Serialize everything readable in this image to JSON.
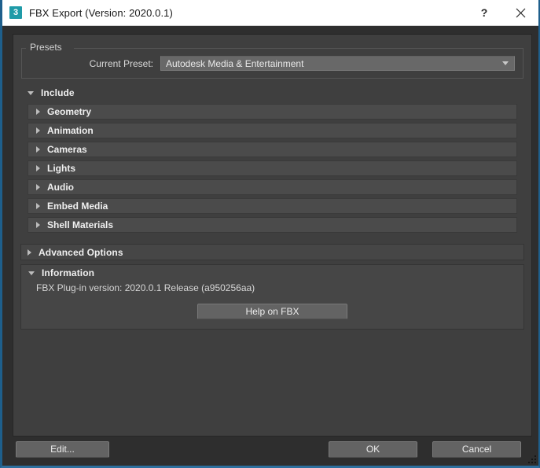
{
  "window": {
    "title": "FBX Export (Version: 2020.0.1)",
    "icon": "3",
    "icon_name": "3ds-max-icon",
    "help_glyph": "?",
    "accent_color": "#1e5f8c",
    "titlebar_bg": "#ffffff",
    "dialog_bg": "#2e2e2e",
    "panel_bg": "#464646"
  },
  "presets": {
    "group_title": "Presets",
    "label": "Current Preset:",
    "value": "Autodesk Media & Entertainment",
    "arrow_icon": "chevron-down-icon"
  },
  "include": {
    "label": "Include",
    "expanded": true,
    "arrow_icon": "triangle-down-icon",
    "items": [
      {
        "label": "Geometry",
        "arrow_icon": "triangle-right-icon",
        "expanded": false
      },
      {
        "label": "Animation",
        "arrow_icon": "triangle-right-icon",
        "expanded": false
      },
      {
        "label": "Cameras",
        "arrow_icon": "triangle-right-icon",
        "expanded": false
      },
      {
        "label": "Lights",
        "arrow_icon": "triangle-right-icon",
        "expanded": false
      },
      {
        "label": "Audio",
        "arrow_icon": "triangle-right-icon",
        "expanded": false
      },
      {
        "label": "Embed Media",
        "arrow_icon": "triangle-right-icon",
        "expanded": false
      },
      {
        "label": "Shell Materials",
        "arrow_icon": "triangle-right-icon",
        "expanded": false
      }
    ]
  },
  "advanced_options": {
    "label": "Advanced Options",
    "expanded": false,
    "arrow_icon": "triangle-right-icon"
  },
  "information": {
    "label": "Information",
    "expanded": true,
    "arrow_icon": "triangle-down-icon",
    "version_text": "FBX Plug-in version: 2020.0.1 Release (a950256aa)",
    "help_button": "Help on FBX"
  },
  "footer": {
    "edit": "Edit...",
    "ok": "OK",
    "cancel": "Cancel"
  }
}
